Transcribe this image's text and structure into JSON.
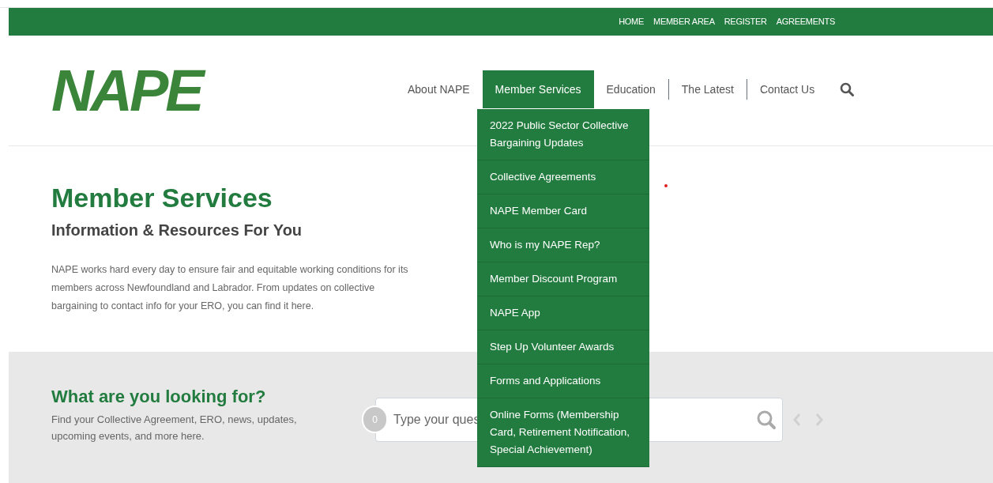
{
  "top_links": [
    "HOME",
    "MEMBER AREA",
    "REGISTER",
    "AGREEMENTS"
  ],
  "logo": "NAPE",
  "nav": [
    {
      "label": "About NAPE",
      "selected": false
    },
    {
      "label": "Member Services",
      "selected": true
    },
    {
      "label": "Education",
      "selected": false
    },
    {
      "label": "The Latest",
      "selected": false
    },
    {
      "label": "Contact Us",
      "selected": false
    }
  ],
  "dropdown": [
    "2022 Public Sector Collective Bargaining Updates",
    "Collective Agreements",
    "NAPE Member Card",
    "Who is my NAPE Rep?",
    "Member Discount Program",
    "NAPE App",
    "Step Up Volunteer Awards",
    "Forms and Applications",
    "Online Forms (Membership Card, Retirement Notification, Special Achievement)"
  ],
  "hero": {
    "title": "Member Services",
    "subtitle": "Information & Resources For You",
    "body": "NAPE works hard every day to ensure fair and equitable working conditions for its members across Newfoundland and Labrador. From updates on collective bargaining to contact info for your ERO, you can find it here."
  },
  "search_section": {
    "title": "What are you looking for?",
    "text": "Find your Collective Agreement, ERO, news, updates, upcoming events, and more here.",
    "counter": "0",
    "placeholder": "Type your ques"
  }
}
